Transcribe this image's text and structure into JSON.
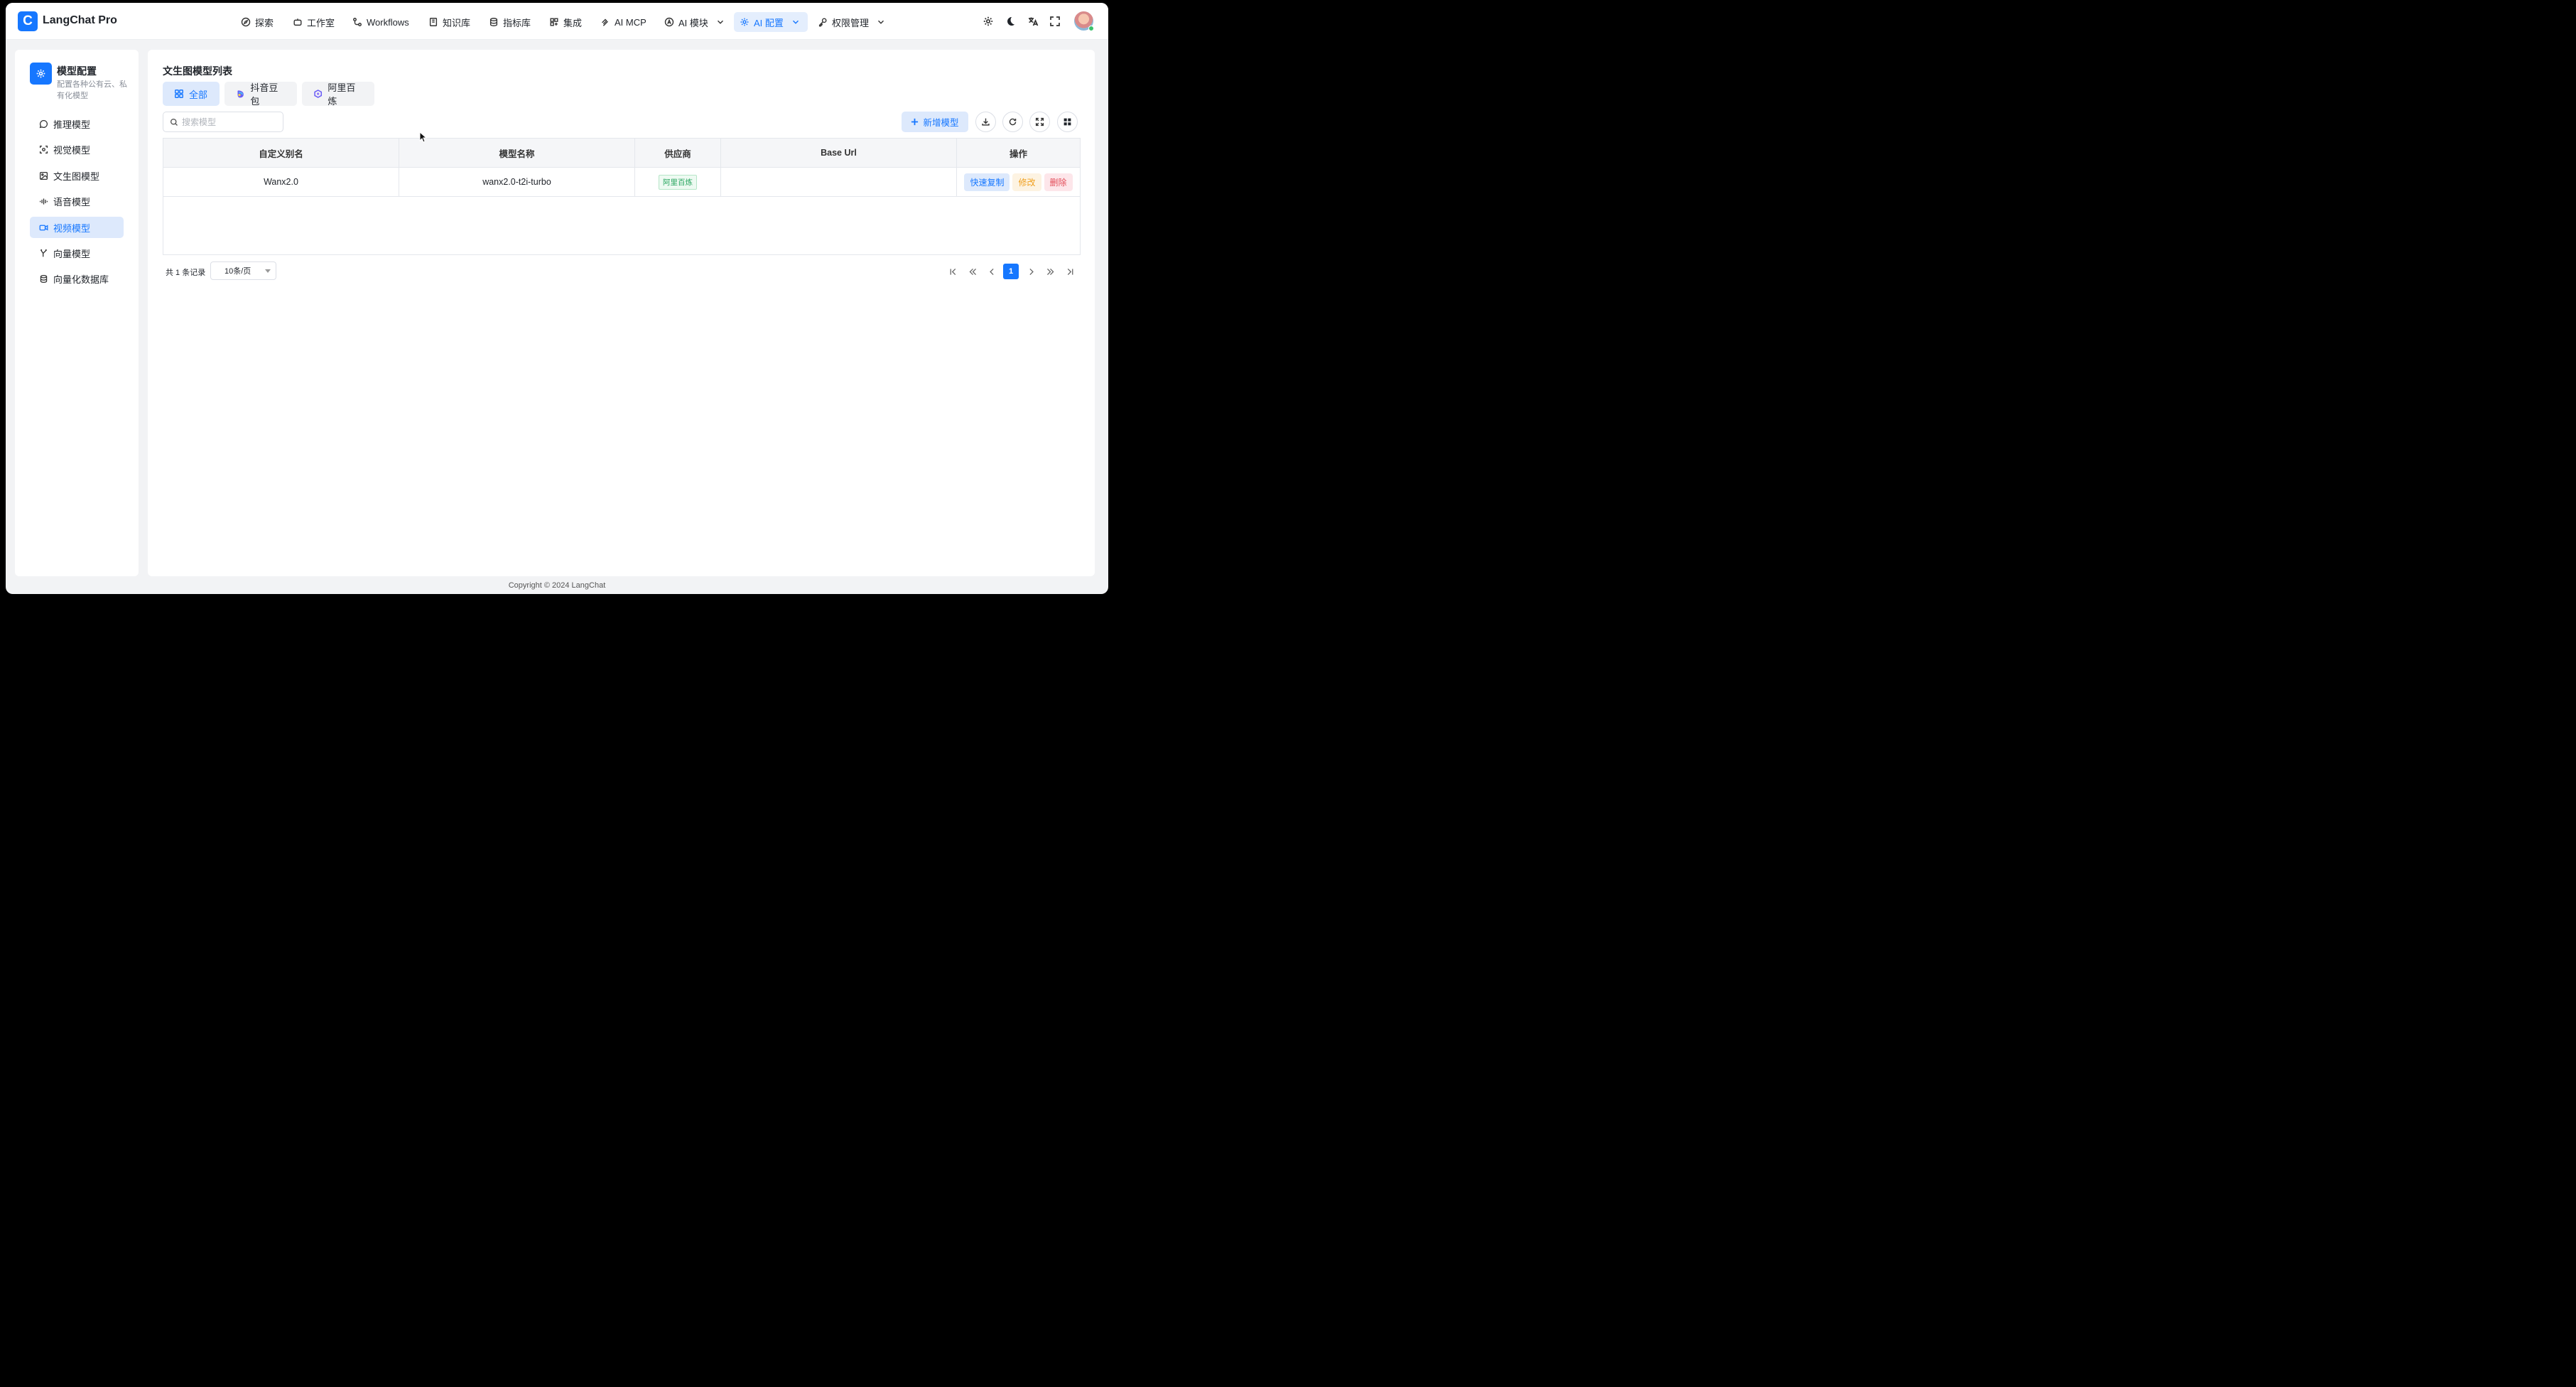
{
  "app": {
    "logo_letter": "C",
    "title": "LangChat Pro"
  },
  "nav": {
    "items": [
      {
        "label": "探索",
        "icon": "compass-icon"
      },
      {
        "label": "工作室",
        "icon": "bot-icon"
      },
      {
        "label": "Workflows",
        "icon": "workflow-icon"
      },
      {
        "label": "知识库",
        "icon": "book-icon"
      },
      {
        "label": "指标库",
        "icon": "database-icon"
      },
      {
        "label": "集成",
        "icon": "grid-plus-icon"
      },
      {
        "label": "AI MCP",
        "icon": "mcp-icon"
      },
      {
        "label": "AI 模块",
        "icon": "ai-module-icon"
      },
      {
        "label": "AI 配置",
        "icon": "gear-icon"
      },
      {
        "label": "权限管理",
        "icon": "key-icon"
      }
    ],
    "active": "AI 配置"
  },
  "sidebar": {
    "title": "模型配置",
    "description": "配置各种公有云、私有化模型",
    "items": [
      {
        "label": "推理模型",
        "icon": "chat-bubble-icon"
      },
      {
        "label": "视觉模型",
        "icon": "scan-eye-icon"
      },
      {
        "label": "文生图模型",
        "icon": "image-icon"
      },
      {
        "label": "语音模型",
        "icon": "audio-wave-icon"
      },
      {
        "label": "视频模型",
        "icon": "video-icon"
      },
      {
        "label": "向量模型",
        "icon": "vector-icon"
      },
      {
        "label": "向量化数据库",
        "icon": "database-icon"
      }
    ],
    "active": "视频模型"
  },
  "main": {
    "title": "文生图模型列表",
    "tabs": [
      {
        "label": "全部",
        "icon": "grid-icon"
      },
      {
        "label": "抖音豆包",
        "icon": "doubao-logo-icon"
      },
      {
        "label": "阿里百炼",
        "icon": "bailian-logo-icon"
      }
    ],
    "active_tab": "全部",
    "search_placeholder": "搜索模型",
    "add_button": "新增模型",
    "table": {
      "columns": [
        "自定义别名",
        "模型名称",
        "供应商",
        "Base Url",
        "操作"
      ],
      "rows": [
        {
          "alias": "Wanx2.0",
          "model": "wanx2.0-t2i-turbo",
          "vendor": "阿里百炼",
          "base_url": ""
        }
      ],
      "actions": {
        "copy": "快速复制",
        "edit": "修改",
        "delete": "删除"
      }
    },
    "pagination": {
      "total_text": "共 1 条记录",
      "page_size": "10条/页",
      "current_page": "1"
    }
  },
  "footer": "Copyright © 2024 LangChat",
  "colors": {
    "primary": "#1677ff",
    "vendor_green": "#28a55f",
    "edit_orange": "#f0a020",
    "delete_red": "#e34d59"
  }
}
